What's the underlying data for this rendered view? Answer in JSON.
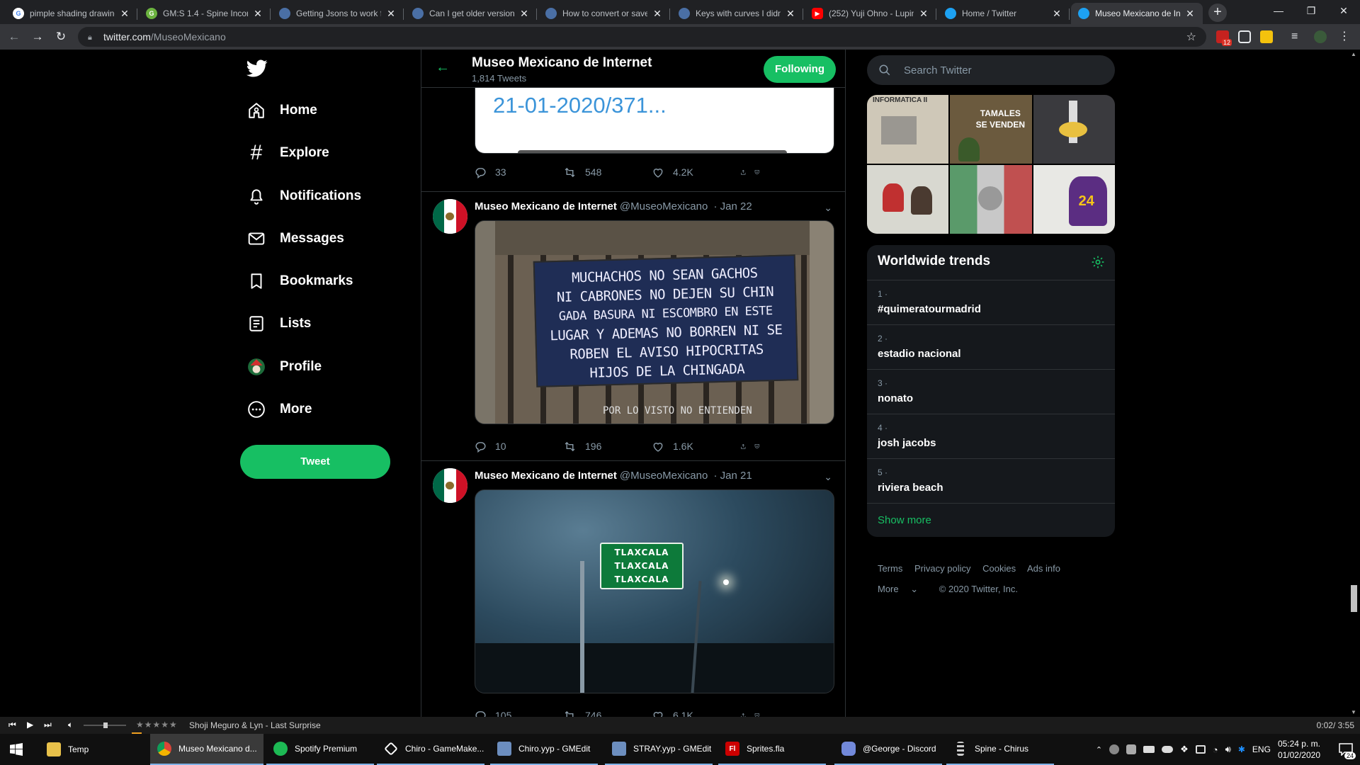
{
  "browser": {
    "tabs": [
      {
        "title": "pimple shading drawing",
        "color": "#ffffff",
        "icon": "google-icon"
      },
      {
        "title": "GM:S 1.4 - Spine Incom",
        "color": "#6bb33f",
        "icon": "gamemaker-icon"
      },
      {
        "title": "Getting Jsons to work f",
        "color": "#4a6fa5",
        "icon": "forum-icon"
      },
      {
        "title": "Can I get older version",
        "color": "#4a6fa5",
        "icon": "forum-icon"
      },
      {
        "title": "How to convert or save",
        "color": "#4a6fa5",
        "icon": "forum-icon"
      },
      {
        "title": "Keys with curves I didn",
        "color": "#4a6fa5",
        "icon": "forum-icon"
      },
      {
        "title": "(252) Yuji Ohno - Lupin",
        "color": "#ff0000",
        "icon": "youtube-icon"
      },
      {
        "title": "Home / Twitter",
        "color": "#1da1f2",
        "icon": "twitter-icon"
      },
      {
        "title": "Museo Mexicano de In",
        "color": "#1da1f2",
        "icon": "twitter-icon"
      }
    ],
    "url_host": "twitter.com",
    "url_path": "/MuseoMexicano",
    "ext_badge": "12"
  },
  "sidebar": {
    "items": [
      {
        "label": "Home",
        "icon": "home-icon"
      },
      {
        "label": "Explore",
        "icon": "hashtag-icon"
      },
      {
        "label": "Notifications",
        "icon": "bell-icon"
      },
      {
        "label": "Messages",
        "icon": "envelope-icon"
      },
      {
        "label": "Bookmarks",
        "icon": "bookmark-icon"
      },
      {
        "label": "Lists",
        "icon": "list-icon"
      },
      {
        "label": "Profile",
        "icon": "profile-avatar-icon"
      },
      {
        "label": "More",
        "icon": "more-circle-icon"
      }
    ],
    "tweet_button": "Tweet"
  },
  "profile_header": {
    "name": "Museo Mexicano de Internet",
    "tweet_count": "1,814 Tweets",
    "follow_label": "Following"
  },
  "tweets": [
    {
      "card_text": "21-01-2020/371...",
      "replies": "33",
      "retweets": "548",
      "likes": "4.2K"
    },
    {
      "display_name": "Museo Mexicano de Internet",
      "handle": "@MuseoMexicano",
      "date": "· Jan 22",
      "sign_lines": [
        "MUCHACHOS NO SEAN GACHOS",
        "NI CABRONES NO DEJEN SU CHIN",
        "GADA BASURA NI ESCOMBRO EN ESTE",
        "LUGAR Y ADEMAS NO BORREN NI SE",
        "ROBEN EL AVISO HIPOCRITAS",
        "HIJOS DE LA CHINGADA"
      ],
      "sign_footer": "POR LO VISTO NO ENTIENDEN",
      "replies": "10",
      "retweets": "196",
      "likes": "1.6K"
    },
    {
      "display_name": "Museo Mexicano de Internet",
      "handle": "@MuseoMexicano",
      "date": "· Jan 21",
      "road_sign": [
        "TLAXCALA",
        "TLAXCALA",
        "TLAXCALA"
      ],
      "replies": "105",
      "retweets": "746",
      "likes": "6.1K"
    }
  ],
  "right": {
    "search_placeholder": "Search Twitter",
    "media_captions": [
      "INFORMATICA II",
      "TAMALES SE VENDEN",
      "",
      "",
      "",
      "24"
    ],
    "trends_title": "Worldwide trends",
    "trends": [
      {
        "rank": "1 ·",
        "name": "#quimeratourmadrid"
      },
      {
        "rank": "2 ·",
        "name": "estadio nacional"
      },
      {
        "rank": "3 ·",
        "name": "nonato"
      },
      {
        "rank": "4 ·",
        "name": "josh jacobs"
      },
      {
        "rank": "5 ·",
        "name": "riviera beach"
      }
    ],
    "show_more": "Show more",
    "footer_links": [
      "Terms",
      "Privacy policy",
      "Cookies",
      "Ads info"
    ],
    "footer_more": "More",
    "copyright": "© 2020 Twitter, Inc."
  },
  "player": {
    "song": "Shoji Meguro & Lyn - Last Surprise",
    "time": "0:02/ 3:55",
    "stars": "★★★★★"
  },
  "taskbar": {
    "items": [
      {
        "label": "Temp",
        "color": "#e8c14a",
        "icon": "folder-icon"
      },
      {
        "label": "Museo Mexicano d...",
        "color": "#db4437",
        "icon": "chrome-icon"
      },
      {
        "label": "Spotify Premium",
        "color": "#1db954",
        "icon": "spotify-icon"
      },
      {
        "label": "Chiro - GameMake...",
        "color": "#ffffff",
        "icon": "gamemaker-icon"
      },
      {
        "label": "Chiro.yyp - GMEdit",
        "color": "#6c8ebf",
        "icon": "gmedit-icon"
      },
      {
        "label": "STRAY.yyp - GMEdit",
        "color": "#6c8ebf",
        "icon": "gmedit-icon"
      },
      {
        "label": "Sprites.fla",
        "color": "#cc0000",
        "icon": "flash-icon"
      },
      {
        "label": "@George - Discord",
        "color": "#7289da",
        "icon": "discord-icon"
      },
      {
        "label": "Spine - Chirus",
        "color": "#cccccc",
        "icon": "spine-icon"
      }
    ],
    "lang": "ENG",
    "time": "05:24 p. m.",
    "date": "01/02/2020",
    "notif_count": "24"
  },
  "colors": {
    "accent": "#17bf63",
    "muted": "#8899a6",
    "border": "#2f3336"
  }
}
